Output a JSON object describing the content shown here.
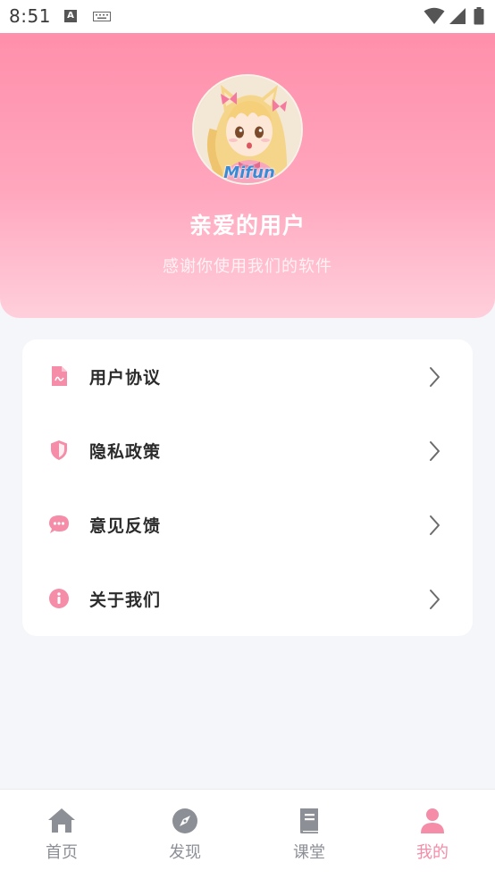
{
  "status_bar": {
    "time": "8:51",
    "a_icon_text": "A"
  },
  "profile": {
    "avatar_logo_text": "Mifun",
    "title": "亲爱的用户",
    "subtitle": "感谢你使用我们的软件"
  },
  "menu": {
    "items": [
      {
        "label": "用户协议",
        "icon": "document-icon"
      },
      {
        "label": "隐私政策",
        "icon": "shield-icon"
      },
      {
        "label": "意见反馈",
        "icon": "chat-bubble-icon"
      },
      {
        "label": "关于我们",
        "icon": "info-icon"
      }
    ]
  },
  "bottom_nav": {
    "items": [
      {
        "label": "首页",
        "icon": "home-icon",
        "active": false
      },
      {
        "label": "发现",
        "icon": "compass-icon",
        "active": false
      },
      {
        "label": "课堂",
        "icon": "book-icon",
        "active": false
      },
      {
        "label": "我的",
        "icon": "person-icon",
        "active": true
      }
    ]
  },
  "colors": {
    "accent": "#f58ca8",
    "header_top": "#ff8fab",
    "header_bottom": "#ffcfdc",
    "icon_gray": "#8d8f96",
    "background": "#f5f6fa"
  }
}
